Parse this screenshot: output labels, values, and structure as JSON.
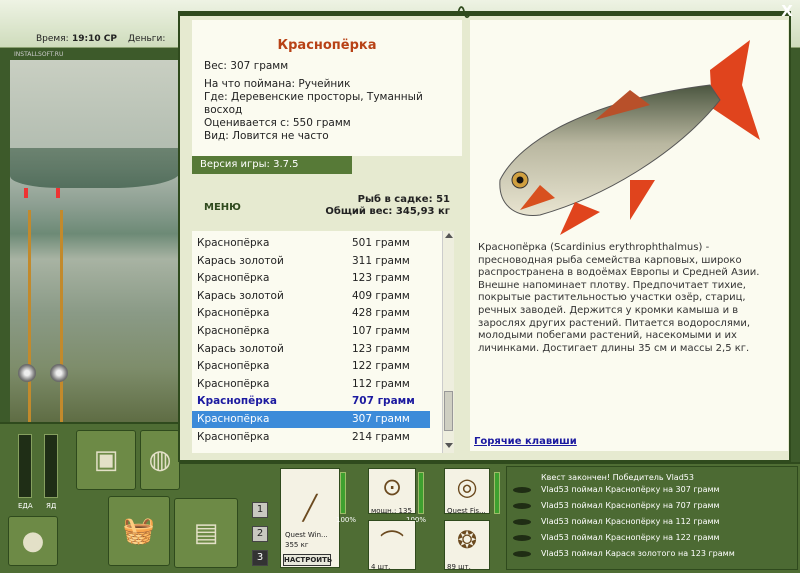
{
  "topbar": {
    "time_label": "Время:",
    "time_value": "19:10 СР",
    "money_label": "Деньги:",
    "watermark": "INSTALLSOFT.RU"
  },
  "left_panel": {
    "meter_food": "ЕДА",
    "meter_poison": "ЯД",
    "pages": [
      "1",
      "2",
      "3"
    ]
  },
  "tackle": {
    "rod_name": "Quest Win...",
    "rod_weight": "355 кг",
    "rod_percent": "100%",
    "reel_label": "мощн.: 135",
    "reel_percent": "100%",
    "line_label": "Quest Fis...",
    "hook_count": "4 шт.",
    "bait_count": "89 шт.",
    "setup_button": "НАСТРОИТЬ"
  },
  "log": {
    "quest": "Квест закончен! Победитель Vlad53",
    "rows": [
      "Vlad53 поймал Краснопёрку на 307 грамм",
      "Vlad53 поймал Краснопёрку на 707 грамм",
      "Vlad53 поймал Краснопёрку на 112 грамм",
      "Vlad53 поймал Краснопёрку на 122 грамм",
      "Vlad53 поймал Карася золотого на 123 грамм"
    ]
  },
  "modal": {
    "close_label": "X",
    "title": "Краснопёрка",
    "weight": "Вес: 307 грамм",
    "caught_on": "На что поймана: Ручейник",
    "where_1": "Где: Деревенские просторы, Туманный",
    "where_2": "восход",
    "valued": "Оценивается с: 550 грамм",
    "kind": "Вид: Ловится не часто",
    "version": "Версия игры: 3.7.5",
    "menu_label": "МЕНЮ",
    "fish_in_net": "Рыб в садке: 51",
    "total_weight": "Общий вес: 345,93 кг",
    "list": [
      {
        "name": "Краснопёрка",
        "weight": "501 грамм"
      },
      {
        "name": "Карась золотой",
        "weight": "311 грамм"
      },
      {
        "name": "Краснопёрка",
        "weight": "123 грамм"
      },
      {
        "name": "Карась золотой",
        "weight": "409 грамм"
      },
      {
        "name": "Краснопёрка",
        "weight": "428 грамм"
      },
      {
        "name": "Краснопёрка",
        "weight": "107 грамм"
      },
      {
        "name": "Карась золотой",
        "weight": "123 грамм"
      },
      {
        "name": "Краснопёрка",
        "weight": "122 грамм"
      },
      {
        "name": "Краснопёрка",
        "weight": "112 грамм"
      },
      {
        "name": "Краснопёрка",
        "weight": "707 грамм"
      },
      {
        "name": "Краснопёрка",
        "weight": "307 грамм"
      },
      {
        "name": "Краснопёрка",
        "weight": "214 грамм"
      }
    ],
    "bold_index": 9,
    "selected_index": 10,
    "description": "Краснопёрка (Scardinius erythrophthalmus) - пресноводная рыба семейства карповых, широко распространена в водоёмах Европы и Средней Азии. Внешне напоминает плотву. Предпочитает тихие, покрытые растительностью участки озёр, стариц, речных заводей. Держится у кромки камыша и в зарослях других растений. Питается водорослями, молодыми побегами растений, насекомыми и их личинками. Достигает длины 35 см и массы 2,5 кг.",
    "hotkeys": "Горячие клавиши"
  },
  "colors": {
    "accent_green": "#577a37",
    "title_orange": "#b84216",
    "selection_blue": "#3c8bd9",
    "link_blue": "#1c1aa0"
  },
  "icons": {
    "close": "close-icon",
    "lizard": "lizard-icon",
    "rod": "rod-icon",
    "reel": "reel-icon",
    "line": "line-icon",
    "hook": "hook-icon",
    "bait": "bait-icon",
    "pot": "pot-icon",
    "basket": "basket-icon",
    "bucket": "bucket-icon",
    "bag": "bag-icon",
    "net": "net-icon"
  }
}
